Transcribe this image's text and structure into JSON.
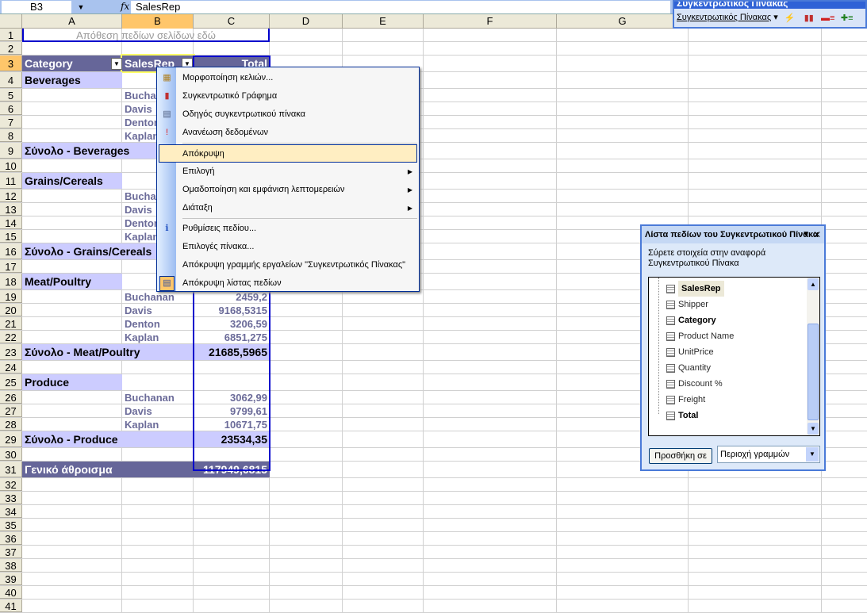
{
  "formula_bar": {
    "name_box": "B3",
    "fx": "fx",
    "value": "SalesRep"
  },
  "columns": [
    "A",
    "B",
    "C",
    "D",
    "E",
    "F",
    "G"
  ],
  "selected_column": "B",
  "selected_row": 3,
  "rows": [
    {
      "n": 1,
      "t": "page",
      "a": "Απόθεση πεδίων σελίδων εδώ"
    },
    {
      "n": 2,
      "t": "n"
    },
    {
      "n": 3,
      "t": "hdr",
      "a": "Category",
      "b": "SalesRep",
      "c": "Total"
    },
    {
      "n": 4,
      "t": "cat",
      "a": "Beverages"
    },
    {
      "n": 5,
      "t": "n",
      "b": "Buchanan"
    },
    {
      "n": 6,
      "t": "n",
      "b": "Davis"
    },
    {
      "n": 7,
      "t": "n",
      "b": "Denton"
    },
    {
      "n": 8,
      "t": "n",
      "b": "Kaplan"
    },
    {
      "n": 9,
      "t": "sub",
      "a": "Σύνολο - Beverages"
    },
    {
      "n": 10,
      "t": "n"
    },
    {
      "n": 11,
      "t": "cat",
      "a": "Grains/Cereals"
    },
    {
      "n": 12,
      "t": "n",
      "b": "Buchanan"
    },
    {
      "n": 13,
      "t": "n",
      "b": "Davis"
    },
    {
      "n": 14,
      "t": "n",
      "b": "Denton"
    },
    {
      "n": 15,
      "t": "n",
      "b": "Kaplan"
    },
    {
      "n": 16,
      "t": "sub",
      "a": "Σύνολο - Grains/Cereals"
    },
    {
      "n": 17,
      "t": "n"
    },
    {
      "n": 18,
      "t": "cat",
      "a": "Meat/Poultry"
    },
    {
      "n": 19,
      "t": "n",
      "b": "Buchanan",
      "c": "2459,2"
    },
    {
      "n": 20,
      "t": "n",
      "b": "Davis",
      "c": "9168,5315"
    },
    {
      "n": 21,
      "t": "n",
      "b": "Denton",
      "c": "3206,59"
    },
    {
      "n": 22,
      "t": "n",
      "b": "Kaplan",
      "c": "6851,275"
    },
    {
      "n": 23,
      "t": "sub",
      "a": "Σύνολο - Meat/Poultry",
      "c": "21685,5965"
    },
    {
      "n": 24,
      "t": "n"
    },
    {
      "n": 25,
      "t": "cat",
      "a": "Produce"
    },
    {
      "n": 26,
      "t": "n",
      "b": "Buchanan",
      "c": "3062,99"
    },
    {
      "n": 27,
      "t": "n",
      "b": "Davis",
      "c": "9799,61"
    },
    {
      "n": 28,
      "t": "n",
      "b": "Kaplan",
      "c": "10671,75"
    },
    {
      "n": 29,
      "t": "sub",
      "a": "Σύνολο - Produce",
      "c": "23534,35"
    },
    {
      "n": 30,
      "t": "n"
    },
    {
      "n": 31,
      "t": "grand",
      "a": "Γενικό άθροισμα",
      "c": "117949,6815"
    },
    {
      "n": 32,
      "t": "n"
    },
    {
      "n": 33,
      "t": "n"
    },
    {
      "n": 34,
      "t": "n"
    },
    {
      "n": 35,
      "t": "n"
    },
    {
      "n": 36,
      "t": "n"
    },
    {
      "n": 37,
      "t": "n"
    },
    {
      "n": 38,
      "t": "n"
    },
    {
      "n": 39,
      "t": "n"
    },
    {
      "n": 40,
      "t": "n"
    },
    {
      "n": 41,
      "t": "n"
    }
  ],
  "context_menu": {
    "items": [
      {
        "label": "Μορφοποίηση κελιών...",
        "icon": "format-cells-icon"
      },
      {
        "label": "Συγκεντρωτικό Γράφημα",
        "icon": "pivot-chart-icon"
      },
      {
        "label": "Οδηγός συγκεντρωτικού πίνακα",
        "icon": "pivot-wizard-icon"
      },
      {
        "label": "Ανανέωση δεδομένων",
        "icon": "refresh-icon"
      },
      {
        "label": "Απόκρυψη",
        "highlighted": true,
        "sep_before": true
      },
      {
        "label": "Επιλογή",
        "submenu": true
      },
      {
        "label": "Ομαδοποίηση και εμφάνιση λεπτομερειών",
        "submenu": true
      },
      {
        "label": "Διάταξη",
        "submenu": true
      },
      {
        "label": "Ρυθμίσεις πεδίου...",
        "icon": "field-settings-icon",
        "sep_before": true
      },
      {
        "label": "Επιλογές πίνακα..."
      },
      {
        "label": "Απόκρυψη γραμμής εργαλείων \"Συγκεντρωτικός Πίνακας\""
      },
      {
        "label": "Απόκρυψη λίστας πεδίων",
        "icon": "field-list-icon",
        "checked": true
      }
    ]
  },
  "pivot_toolbar": {
    "title": "Συγκεντρωτικός Πίνακας",
    "menu": "Συγκεντρωτικός Πίνακας"
  },
  "field_list": {
    "title": "Λίστα πεδίων του Συγκεντρωτικού Πίνακα",
    "hint": "Σύρετε στοιχεία στην αναφορά Συγκεντρωτικού Πίνακα",
    "fields": [
      {
        "name": "SalesRep",
        "bold": true,
        "selected": true
      },
      {
        "name": "Shipper"
      },
      {
        "name": "Category",
        "bold": true
      },
      {
        "name": "Product Name"
      },
      {
        "name": "UnitPrice"
      },
      {
        "name": "Quantity"
      },
      {
        "name": "Discount %"
      },
      {
        "name": "Freight"
      },
      {
        "name": "Total",
        "bold": true
      }
    ],
    "add_button": "Προσθήκη σε",
    "area_select": "Περιοχή γραμμών"
  }
}
